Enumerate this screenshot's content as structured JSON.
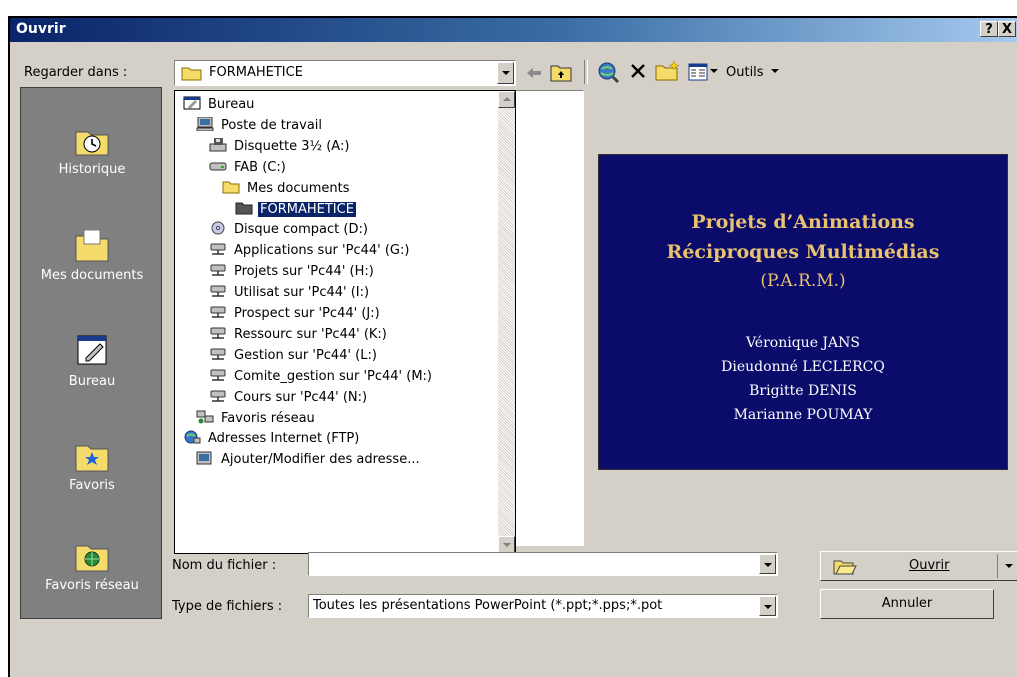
{
  "title": "Ouvrir",
  "caption_buttons": {
    "help": "?",
    "close": "X"
  },
  "look_in": {
    "label": "Regarder dans :",
    "value": "FORMAHETICE"
  },
  "toolbar": {
    "tools": "Outils"
  },
  "places": [
    {
      "label": "Historique",
      "icon": "history-icon"
    },
    {
      "label": "Mes documents",
      "icon": "my-documents-icon"
    },
    {
      "label": "Bureau",
      "icon": "desktop-icon"
    },
    {
      "label": "Favoris",
      "icon": "favorites-icon"
    },
    {
      "label": "Favoris réseau",
      "icon": "network-favorites-icon"
    }
  ],
  "dropdown_items": [
    {
      "label": "Bureau",
      "icon": "desktop-icon",
      "level": 0
    },
    {
      "label": "Poste de travail",
      "icon": "computer-icon",
      "level": 1
    },
    {
      "label": "Disquette 3½ (A:)",
      "icon": "floppy-icon",
      "level": 2
    },
    {
      "label": "FAB (C:)",
      "icon": "harddrive-icon",
      "level": 2
    },
    {
      "label": "Mes documents",
      "icon": "folder-icon",
      "level": 3
    },
    {
      "label": "FORMAHETICE",
      "icon": "folder-open-icon",
      "level": 4,
      "selected": true
    },
    {
      "label": "Disque compact (D:)",
      "icon": "cdrom-icon",
      "level": 2
    },
    {
      "label": "Applications sur 'Pc44' (G:)",
      "icon": "network-drive-icon",
      "level": 2
    },
    {
      "label": "Projets sur 'Pc44' (H:)",
      "icon": "network-drive-icon",
      "level": 2
    },
    {
      "label": "Utilisat sur 'Pc44' (I:)",
      "icon": "network-drive-icon",
      "level": 2
    },
    {
      "label": "Prospect sur 'Pc44' (J:)",
      "icon": "network-drive-icon",
      "level": 2
    },
    {
      "label": "Ressourc sur 'Pc44' (K:)",
      "icon": "network-drive-icon",
      "level": 2
    },
    {
      "label": "Gestion sur 'Pc44' (L:)",
      "icon": "network-drive-icon",
      "level": 2
    },
    {
      "label": "Comite_gestion sur 'Pc44' (M:)",
      "icon": "network-drive-icon",
      "level": 2
    },
    {
      "label": "Cours sur 'Pc44' (N:)",
      "icon": "network-drive-icon",
      "level": 2
    },
    {
      "label": "Favoris réseau",
      "icon": "network-places-icon",
      "level": 1
    },
    {
      "label": "Adresses Internet (FTP)",
      "icon": "ftp-icon",
      "level": 0
    },
    {
      "label": "Ajouter/Modifier des adresse...",
      "icon": "ftp-edit-icon",
      "level": 1
    }
  ],
  "preview": {
    "title_line1": "Projets d’Animations",
    "title_line2": "Réciproques Multimédias",
    "title_line3": "(P.A.R.M.)",
    "authors": [
      "Véronique JANS",
      "Dieudonné LECLERCQ",
      "Brigitte DENIS",
      "Marianne POUMAY"
    ]
  },
  "filename": {
    "label": "Nom du fichier :",
    "value": ""
  },
  "filetype": {
    "label": "Type de fichiers :",
    "value": "Toutes les présentations PowerPoint (*.ppt;*.pps;*.pot"
  },
  "buttons": {
    "open": "Ouvrir",
    "cancel": "Annuler"
  },
  "colors": {
    "title_start": "#0a246a",
    "preview_bg": "#0b0b6b",
    "preview_title": "#e8c26e",
    "selection": "#0a246a"
  }
}
